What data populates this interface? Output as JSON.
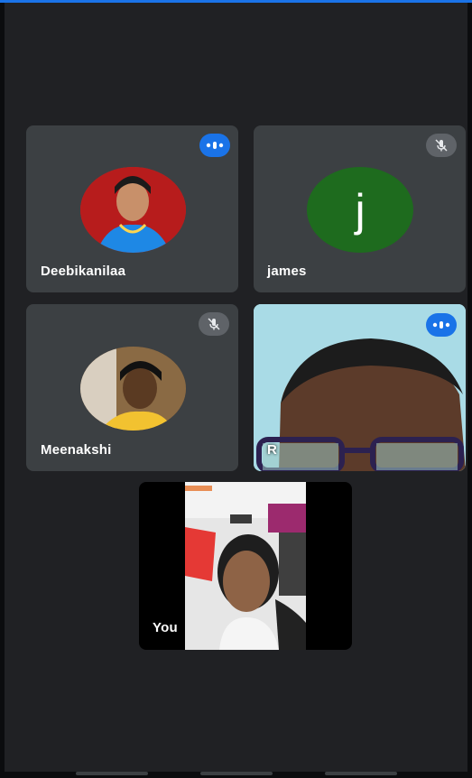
{
  "participants": [
    {
      "name": "Deebikanilaa",
      "status_icon": "speaking-dots-icon"
    },
    {
      "name": "james",
      "initial": "j",
      "avatar_color": "#1e6b1e",
      "status_icon": "mic-off-icon"
    },
    {
      "name": "Meenakshi",
      "status_icon": "mic-off-icon"
    },
    {
      "name": "R",
      "status_icon": "speaking-dots-icon"
    }
  ],
  "self": {
    "name": "You"
  },
  "colors": {
    "accent": "#1a73e8",
    "tile": "#3c4043",
    "background": "#202124"
  }
}
